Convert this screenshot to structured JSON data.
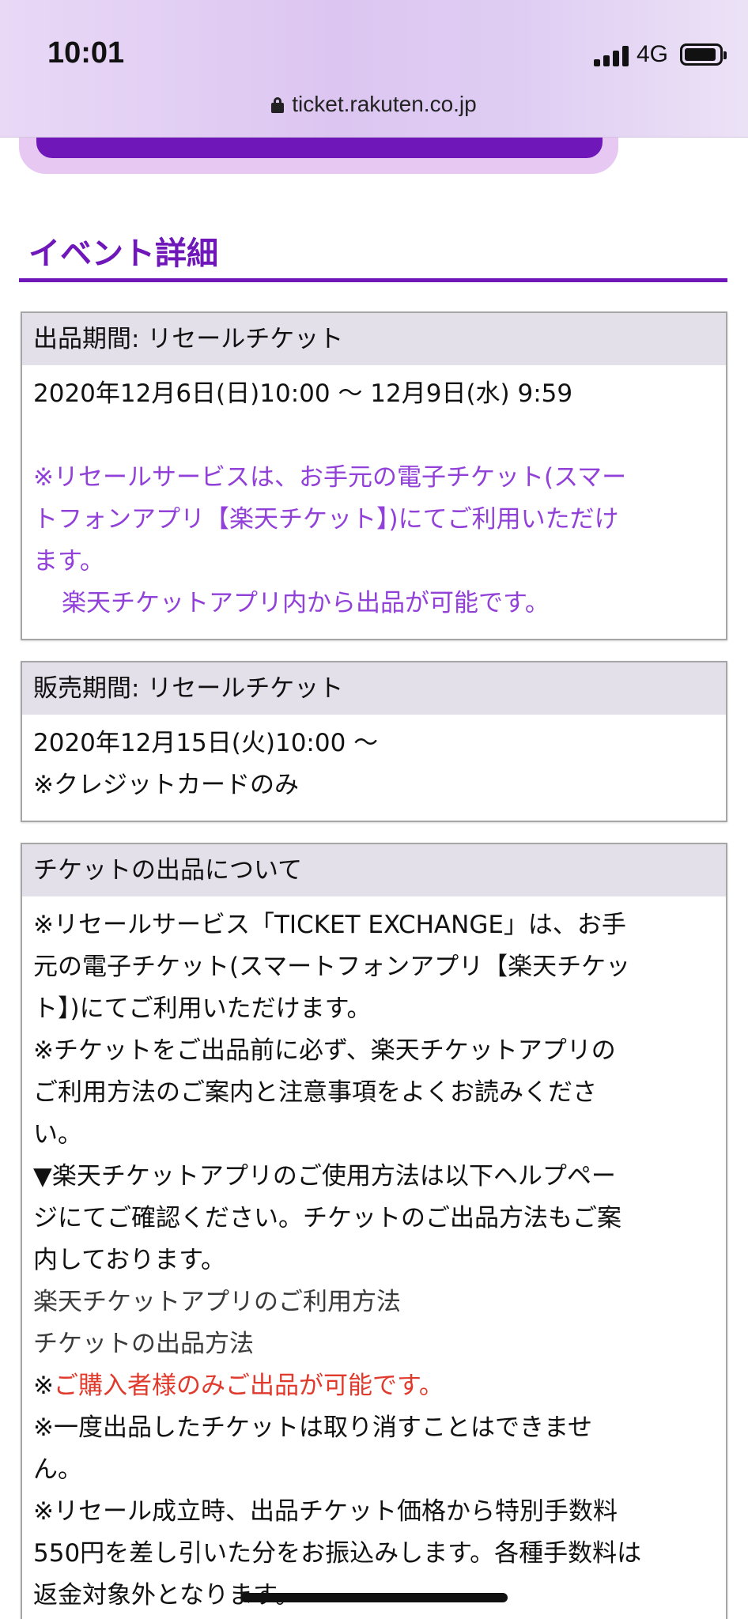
{
  "status_bar": {
    "time": "10:01",
    "network": "4G",
    "url": "ticket.rakuten.co.jp"
  },
  "section": {
    "title": "イベント詳細"
  },
  "boxes": [
    {
      "header": "出品期間: リセールチケット",
      "line1": "2020年12月6日(日)10:00 〜 12月9日(水) 9:59",
      "note_lines": [
        "※リセールサービスは、お手元の電子チケット(スマー",
        "トフォンアプリ【楽天チケット】)にてご利用いただけ",
        "ます。",
        "楽天チケットアプリ内から出品が可能です。"
      ]
    },
    {
      "header": "販売期間: リセールチケット",
      "lines": [
        "2020年12月15日(火)10:00 〜",
        "※クレジットカードのみ"
      ]
    },
    {
      "header": "チケットの出品について",
      "lines": [
        "※リセールサービス「TICKET EXCHANGE」は、お手",
        "元の電子チケット(スマートフォンアプリ【楽天チケッ",
        "ト】)にてご利用いただけます。",
        "※チケットをご出品前に必ず、楽天チケットアプリの",
        "ご利用方法のご案内と注意事項をよくお読みくださ",
        "い。",
        "▼楽天チケットアプリのご使用方法は以下ヘルプペー",
        "ジにてご確認ください。チケットのご出品方法もご案",
        "内しております。"
      ],
      "link1": "楽天チケットアプリのご利用方法",
      "link2": "チケットの出品方法",
      "red_prefix": "※",
      "red_text": "ご購入者様のみご出品が可能です。",
      "lines2": [
        "※一度出品したチケットは取り消すことはできませ",
        "ん。",
        "※リセール成立時、出品チケット価格から特別手数料",
        "550円を差し引いた分をお振込みします。各種手数料は",
        "返金対象外となります。"
      ]
    }
  ]
}
